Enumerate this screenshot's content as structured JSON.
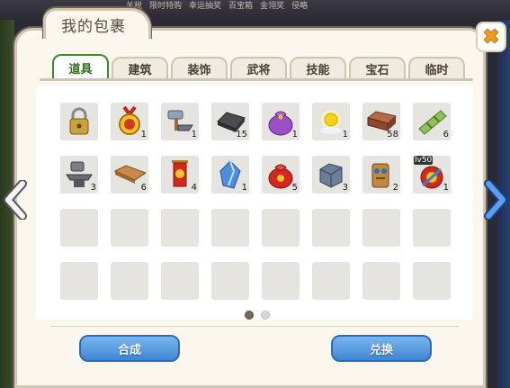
{
  "background_menu": [
    "关税",
    "限时特购",
    "幸运抽奖",
    "百宝箱",
    "金翎奖",
    "侵略"
  ],
  "window": {
    "title": "我的包裹",
    "close_icon": "close-x-icon"
  },
  "tabs": [
    {
      "label": "道具",
      "active": true
    },
    {
      "label": "建筑",
      "active": false
    },
    {
      "label": "装饰",
      "active": false
    },
    {
      "label": "武将",
      "active": false
    },
    {
      "label": "技能",
      "active": false
    },
    {
      "label": "宝石",
      "active": false
    },
    {
      "label": "临时",
      "active": false
    }
  ],
  "items": [
    {
      "icon": "padlock-icon",
      "count": ""
    },
    {
      "icon": "gold-medal-icon",
      "count": "1"
    },
    {
      "icon": "hammer-anvil-icon",
      "count": "1"
    },
    {
      "icon": "iron-ingot-icon",
      "count": "15"
    },
    {
      "icon": "purple-pouch-icon",
      "count": "1"
    },
    {
      "icon": "sun-icon",
      "count": "1"
    },
    {
      "icon": "brick-icon",
      "count": "58"
    },
    {
      "icon": "bamboo-scroll-icon",
      "count": "6"
    },
    {
      "icon": "stone-anvil-icon",
      "count": "3"
    },
    {
      "icon": "wooden-plank-icon",
      "count": "6"
    },
    {
      "icon": "red-banner-icon",
      "count": "4"
    },
    {
      "icon": "blue-crystal-icon",
      "count": "1"
    },
    {
      "icon": "red-pouch-icon",
      "count": "5"
    },
    {
      "icon": "stone-block-icon",
      "count": "3"
    },
    {
      "icon": "wooden-totem-icon",
      "count": "2"
    },
    {
      "icon": "lv50-gift-icon",
      "count": "1",
      "badge": "lv50"
    }
  ],
  "pagination": {
    "current": 1,
    "total": 2
  },
  "buttons": {
    "combine": "合成",
    "exchange": "兑换"
  },
  "nav": {
    "prev_icon": "chevron-left-icon",
    "next_icon": "chevron-right-icon"
  }
}
